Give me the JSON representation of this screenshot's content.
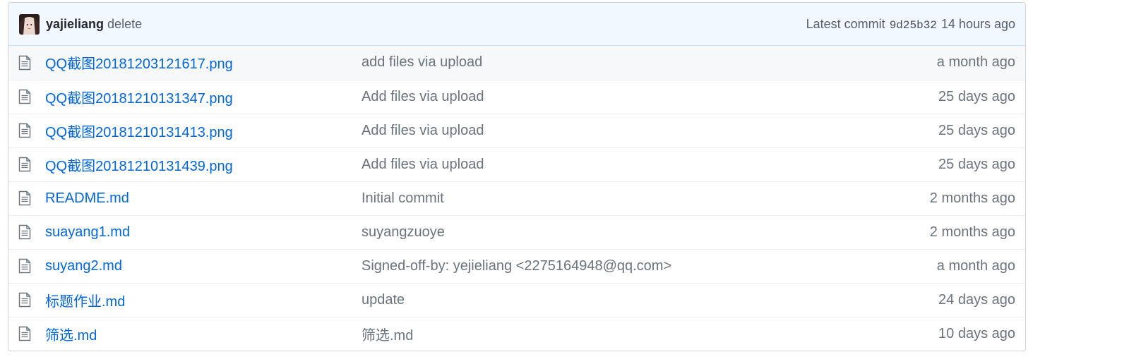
{
  "commit": {
    "author": "yajieliang",
    "message": "delete",
    "label": "Latest commit",
    "sha": "9d25b32",
    "age": "14 hours ago"
  },
  "files": [
    {
      "name": "QQ截图20181203121617.png",
      "message": "add files via upload",
      "age": "a month ago"
    },
    {
      "name": "QQ截图20181210131347.png",
      "message": "Add files via upload",
      "age": "25 days ago"
    },
    {
      "name": "QQ截图20181210131413.png",
      "message": "Add files via upload",
      "age": "25 days ago"
    },
    {
      "name": "QQ截图20181210131439.png",
      "message": "Add files via upload",
      "age": "25 days ago"
    },
    {
      "name": "README.md",
      "message": "Initial commit",
      "age": "2 months ago"
    },
    {
      "name": "suayang1.md",
      "message": "suyangzuoye",
      "age": "2 months ago"
    },
    {
      "name": "suyang2.md",
      "message": "Signed-off-by: yejieliang <2275164948@qq.com>",
      "age": "a month ago"
    },
    {
      "name": "标题作业.md",
      "message": "update",
      "age": "24 days ago"
    },
    {
      "name": "筛选.md",
      "message": "筛选.md",
      "age": "10 days ago"
    }
  ],
  "icons": {
    "file_icon": "file-text-icon",
    "avatar": "user-avatar"
  },
  "colors": {
    "link": "#0366d6",
    "header_bg": "#f1f8ff",
    "muted": "#6a737d"
  }
}
